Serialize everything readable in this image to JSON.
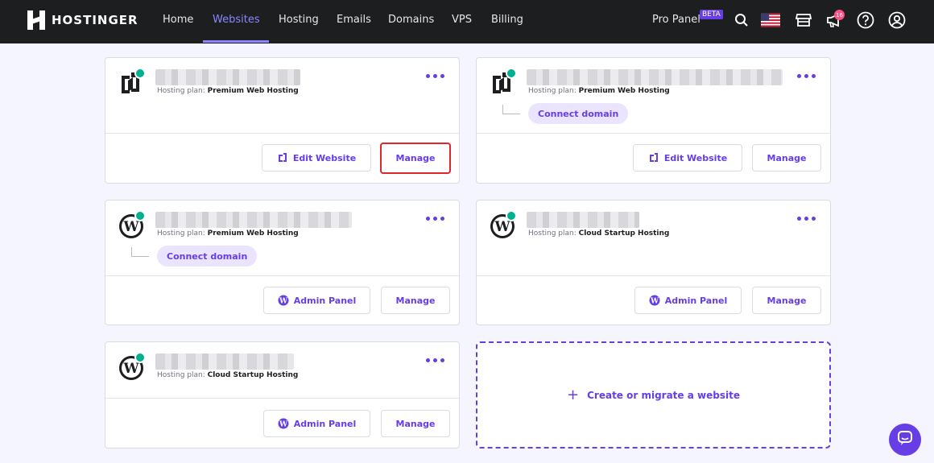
{
  "brand": {
    "name": "HOSTINGER"
  },
  "nav": {
    "items": [
      {
        "label": "Home",
        "active": false
      },
      {
        "label": "Websites",
        "active": true
      },
      {
        "label": "Hosting",
        "active": false
      },
      {
        "label": "Emails",
        "active": false
      },
      {
        "label": "Domains",
        "active": false
      },
      {
        "label": "VPS",
        "active": false
      },
      {
        "label": "Billing",
        "active": false
      }
    ],
    "pro_panel": "Pro Panel",
    "beta_label": "BETA",
    "notifications_count": "16"
  },
  "cards": [
    {
      "plan_label": "Hosting plan: ",
      "plan": "Premium Web Hosting",
      "platform": "builder",
      "buttons": [
        "Edit Website",
        "Manage"
      ],
      "connect_domain": ""
    },
    {
      "plan_label": "Hosting plan: ",
      "plan": "Premium Web Hosting",
      "platform": "builder",
      "buttons": [
        "Edit Website",
        "Manage"
      ],
      "connect_domain": "Connect domain"
    },
    {
      "plan_label": "Hosting plan: ",
      "plan": "Premium Web Hosting",
      "platform": "wordpress",
      "buttons": [
        "Admin Panel",
        "Manage"
      ],
      "connect_domain": "Connect domain"
    },
    {
      "plan_label": "Hosting plan: ",
      "plan": "Cloud Startup Hosting",
      "platform": "wordpress",
      "buttons": [
        "Admin Panel",
        "Manage"
      ],
      "connect_domain": ""
    },
    {
      "plan_label": "Hosting plan: ",
      "plan": "Cloud Startup Hosting",
      "platform": "wordpress",
      "buttons": [
        "Admin Panel",
        "Manage"
      ],
      "connect_domain": ""
    }
  ],
  "create": {
    "label": "Create or migrate a website"
  },
  "colors": {
    "accent": "#673de6",
    "nav_bg": "#1d1e20",
    "status_dot": "#00b090",
    "highlight": "#e0252b"
  }
}
